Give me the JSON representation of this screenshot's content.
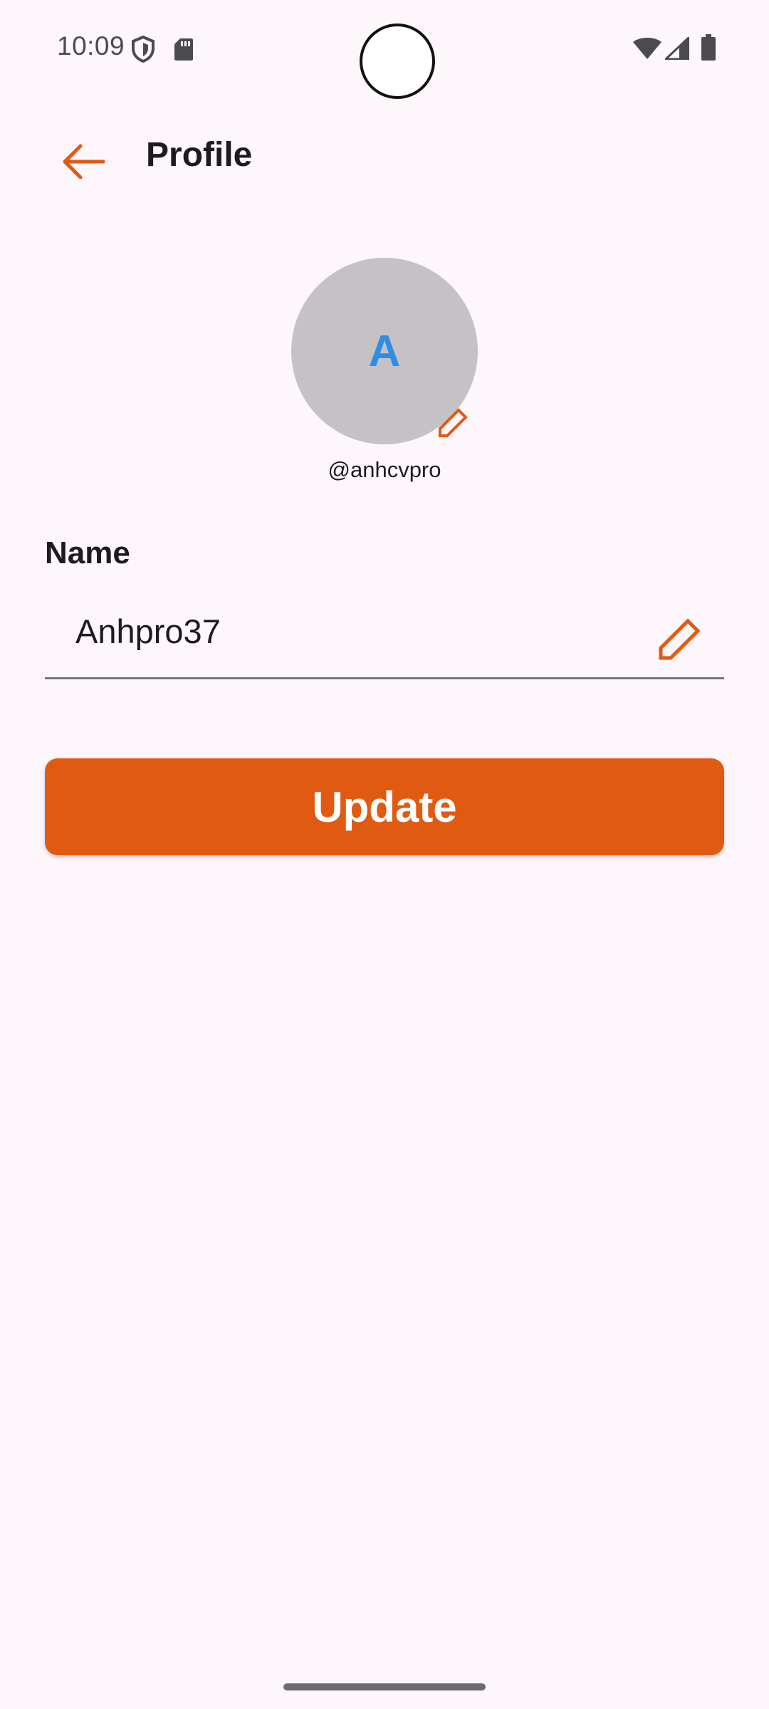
{
  "status_bar": {
    "time": "10:09",
    "icons": [
      "shield-icon",
      "sd-card-icon",
      "wifi-icon",
      "signal-icon",
      "battery-icon"
    ]
  },
  "app_bar": {
    "title": "Profile",
    "back_icon": "arrow-left-icon"
  },
  "profile": {
    "avatar_initial": "A",
    "username": "@anhcvpro"
  },
  "form": {
    "name_label": "Name",
    "name_value": "Anhpro37"
  },
  "actions": {
    "update_label": "Update"
  },
  "colors": {
    "accent": "#e05a12",
    "background": "#fdf6fb",
    "avatar_bg": "#c4c2c5",
    "avatar_text": "#2d8ee4"
  }
}
